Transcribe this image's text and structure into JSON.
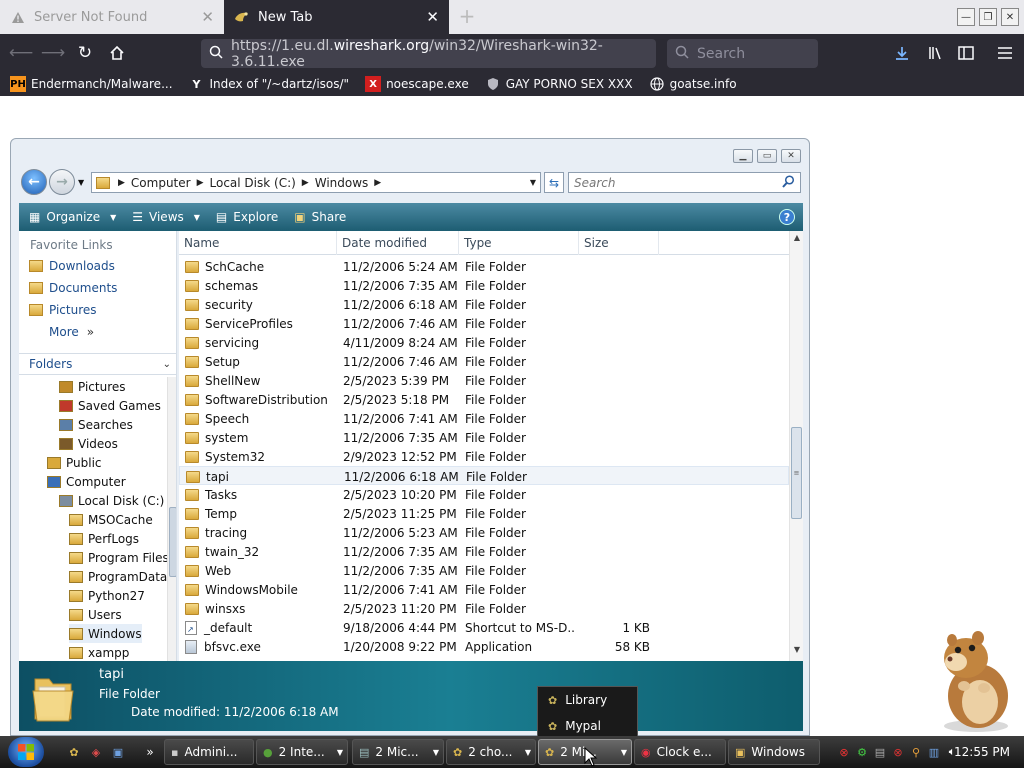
{
  "browser": {
    "tabs": [
      {
        "title": "Server Not Found",
        "active": false
      },
      {
        "title": "New Tab",
        "active": true
      }
    ],
    "url_pre": "https://1.eu.dl.",
    "url_host": "wireshark.org",
    "url_post": "/win32/Wireshark-win32-3.6.11.exe",
    "search_placeholder": "Search",
    "bookmarks": [
      {
        "label": "Endermanch/Malware...",
        "icon": "PH"
      },
      {
        "label": "Index of \"/~dartz/isos/\"",
        "icon": "Y"
      },
      {
        "label": "noescape.exe",
        "icon": "X"
      },
      {
        "label": "GAY PORNO SEX XXX",
        "icon": "shield"
      },
      {
        "label": "goatse.info",
        "icon": "globe"
      }
    ]
  },
  "explorer": {
    "breadcrumbs": [
      "Computer",
      "Local Disk (C:)",
      "Windows"
    ],
    "search_placeholder": "Search",
    "commands": {
      "organize": "Organize",
      "views": "Views",
      "explore": "Explore",
      "share": "Share"
    },
    "favorite_links_header": "Favorite Links",
    "favorites": [
      "Downloads",
      "Documents",
      "Pictures"
    ],
    "more_label": "More",
    "folders_header": "Folders",
    "tree": [
      {
        "label": "Pictures",
        "level": 2
      },
      {
        "label": "Saved Games",
        "level": 2
      },
      {
        "label": "Searches",
        "level": 2
      },
      {
        "label": "Videos",
        "level": 2
      },
      {
        "label": "Public",
        "level": 1
      },
      {
        "label": "Computer",
        "level": 1
      },
      {
        "label": "Local Disk (C:)",
        "level": 2
      },
      {
        "label": "MSOCache",
        "level": 3
      },
      {
        "label": "PerfLogs",
        "level": 3
      },
      {
        "label": "Program Files",
        "level": 3
      },
      {
        "label": "ProgramData",
        "level": 3
      },
      {
        "label": "Python27",
        "level": 3
      },
      {
        "label": "Users",
        "level": 3
      },
      {
        "label": "Windows",
        "level": 3,
        "selected": true
      },
      {
        "label": "xampp",
        "level": 3
      }
    ],
    "columns": [
      "Name",
      "Date modified",
      "Type",
      "Size"
    ],
    "files": [
      {
        "name": "SchCache",
        "date": "11/2/2006 5:24 AM",
        "type": "File Folder",
        "size": ""
      },
      {
        "name": "schemas",
        "date": "11/2/2006 7:35 AM",
        "type": "File Folder",
        "size": ""
      },
      {
        "name": "security",
        "date": "11/2/2006 6:18 AM",
        "type": "File Folder",
        "size": ""
      },
      {
        "name": "ServiceProfiles",
        "date": "11/2/2006 7:46 AM",
        "type": "File Folder",
        "size": ""
      },
      {
        "name": "servicing",
        "date": "4/11/2009 8:24 AM",
        "type": "File Folder",
        "size": ""
      },
      {
        "name": "Setup",
        "date": "11/2/2006 7:46 AM",
        "type": "File Folder",
        "size": ""
      },
      {
        "name": "ShellNew",
        "date": "2/5/2023 5:39 PM",
        "type": "File Folder",
        "size": ""
      },
      {
        "name": "SoftwareDistribution",
        "date": "2/5/2023 5:18 PM",
        "type": "File Folder",
        "size": ""
      },
      {
        "name": "Speech",
        "date": "11/2/2006 7:41 AM",
        "type": "File Folder",
        "size": ""
      },
      {
        "name": "system",
        "date": "11/2/2006 7:35 AM",
        "type": "File Folder",
        "size": ""
      },
      {
        "name": "System32",
        "date": "2/9/2023 12:52 PM",
        "type": "File Folder",
        "size": ""
      },
      {
        "name": "tapi",
        "date": "11/2/2006 6:18 AM",
        "type": "File Folder",
        "size": "",
        "selected": true
      },
      {
        "name": "Tasks",
        "date": "2/5/2023 10:20 PM",
        "type": "File Folder",
        "size": ""
      },
      {
        "name": "Temp",
        "date": "2/5/2023 11:25 PM",
        "type": "File Folder",
        "size": ""
      },
      {
        "name": "tracing",
        "date": "11/2/2006 5:23 AM",
        "type": "File Folder",
        "size": ""
      },
      {
        "name": "twain_32",
        "date": "11/2/2006 7:35 AM",
        "type": "File Folder",
        "size": ""
      },
      {
        "name": "Web",
        "date": "11/2/2006 7:35 AM",
        "type": "File Folder",
        "size": ""
      },
      {
        "name": "WindowsMobile",
        "date": "11/2/2006 7:41 AM",
        "type": "File Folder",
        "size": ""
      },
      {
        "name": "winsxs",
        "date": "2/5/2023 11:20 PM",
        "type": "File Folder",
        "size": ""
      },
      {
        "name": "_default",
        "date": "9/18/2006 4:44 PM",
        "type": "Shortcut to MS-D...",
        "size": "1 KB",
        "icon": "shortcut"
      },
      {
        "name": "bfsvc.exe",
        "date": "1/20/2008 9:22 PM",
        "type": "Application",
        "size": "58 KB",
        "icon": "app"
      }
    ],
    "details": {
      "name": "tapi",
      "type": "File Folder",
      "modified_label": "Date modified:",
      "modified": "11/2/2006 6:18 AM"
    }
  },
  "popup_menu": [
    "Library",
    "Mypal"
  ],
  "taskbar": {
    "buttons": [
      {
        "label": "Admini...",
        "icon": "cmd"
      },
      {
        "label": "2 Inte...",
        "icon": "ie"
      },
      {
        "label": "2 Mic...",
        "icon": "window"
      },
      {
        "label": "2 cho...",
        "icon": "app"
      },
      {
        "label": "2 Mi...",
        "icon": "app",
        "active": true
      },
      {
        "label": "Clock e...",
        "icon": "chrome"
      },
      {
        "label": "Windows",
        "icon": "folder"
      }
    ],
    "clock": "12:55 PM"
  },
  "colors": {
    "firefox_dark": "#2b2a33",
    "explorer_cmdbar": "#1d5d72",
    "details_teal": "#1a7f93",
    "link_blue": "#1e4e8c"
  }
}
